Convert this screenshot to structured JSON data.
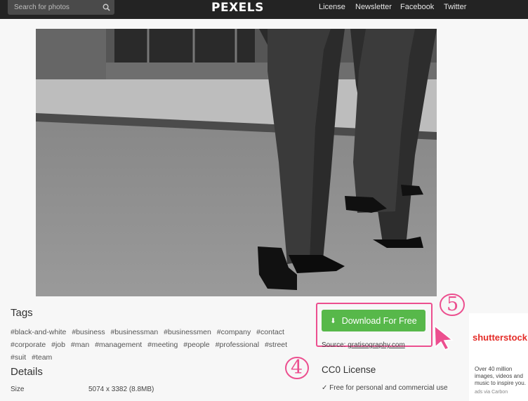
{
  "header": {
    "search_placeholder": "Search for photos",
    "logo": "PEXELS",
    "nav": [
      "License",
      "Newsletter",
      "Facebook",
      "Twitter"
    ]
  },
  "photo": {
    "description_icon": "photo-image"
  },
  "tags": {
    "title": "Tags",
    "items": [
      "#black-and-white",
      "#business",
      "#businessman",
      "#businessmen",
      "#company",
      "#contact",
      "#corporate",
      "#job",
      "#man",
      "#management",
      "#meeting",
      "#people",
      "#professional",
      "#street",
      "#suit",
      "#team"
    ]
  },
  "details": {
    "title": "Details",
    "size_label": "Size",
    "size_value": "5074 x 3382 (8.8MB)"
  },
  "download": {
    "button_label": "Download For Free",
    "source_label": "Source:",
    "source_link": "gratisography.com",
    "license_title": "CC0 License",
    "license_item": "✓ Free for personal and commercial use"
  },
  "annotations": {
    "step_a": "5",
    "step_b": "4"
  },
  "ad": {
    "brand": "shutterstock",
    "copy": "Over 40 million images, videos and music to inspire you.",
    "via": "ads via Carbon"
  },
  "colors": {
    "accent_green": "#57b84a",
    "annotation_pink": "#ec4f8f",
    "topbar": "#232323"
  }
}
